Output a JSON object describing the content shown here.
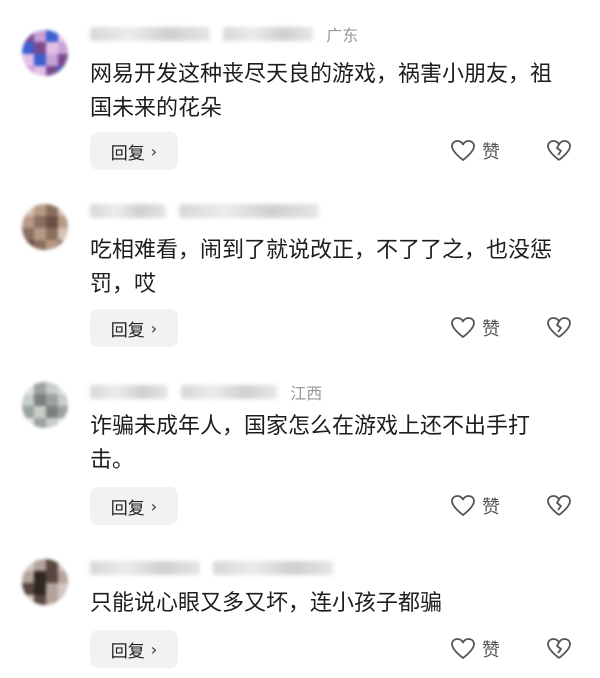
{
  "comments": [
    {
      "region": "广东",
      "text": "网易开发这种丧尽天良的游戏，祸害小朋友，祖国未来的花朵",
      "reply_label": "回复",
      "like_label": "赞",
      "avatar_colors": [
        "#7a4a8f",
        "#c9a3d6",
        "#3b5fcf",
        "#e6c0e9"
      ]
    },
    {
      "region": "",
      "text": "吃相难看，闹到了就说改正，不了了之，也没惩罚，哎",
      "reply_label": "回复",
      "like_label": "赞",
      "avatar_colors": [
        "#b89a86",
        "#8a6f5f",
        "#d6c4b8",
        "#6a4f45"
      ]
    },
    {
      "region": "江西",
      "text": "诈骗未成年人，国家怎么在游戏上还不出手打击。",
      "reply_label": "回复",
      "like_label": "赞",
      "avatar_colors": [
        "#9aa3a0",
        "#c8cec9",
        "#7b827e",
        "#e1e4e1"
      ]
    },
    {
      "region": "",
      "text": "只能说心眼又多又坏，连小孩子都骗",
      "reply_label": "回复",
      "like_label": "赞",
      "avatar_colors": [
        "#5a4640",
        "#b4a39b",
        "#2f2724",
        "#d3c7c1"
      ]
    }
  ]
}
